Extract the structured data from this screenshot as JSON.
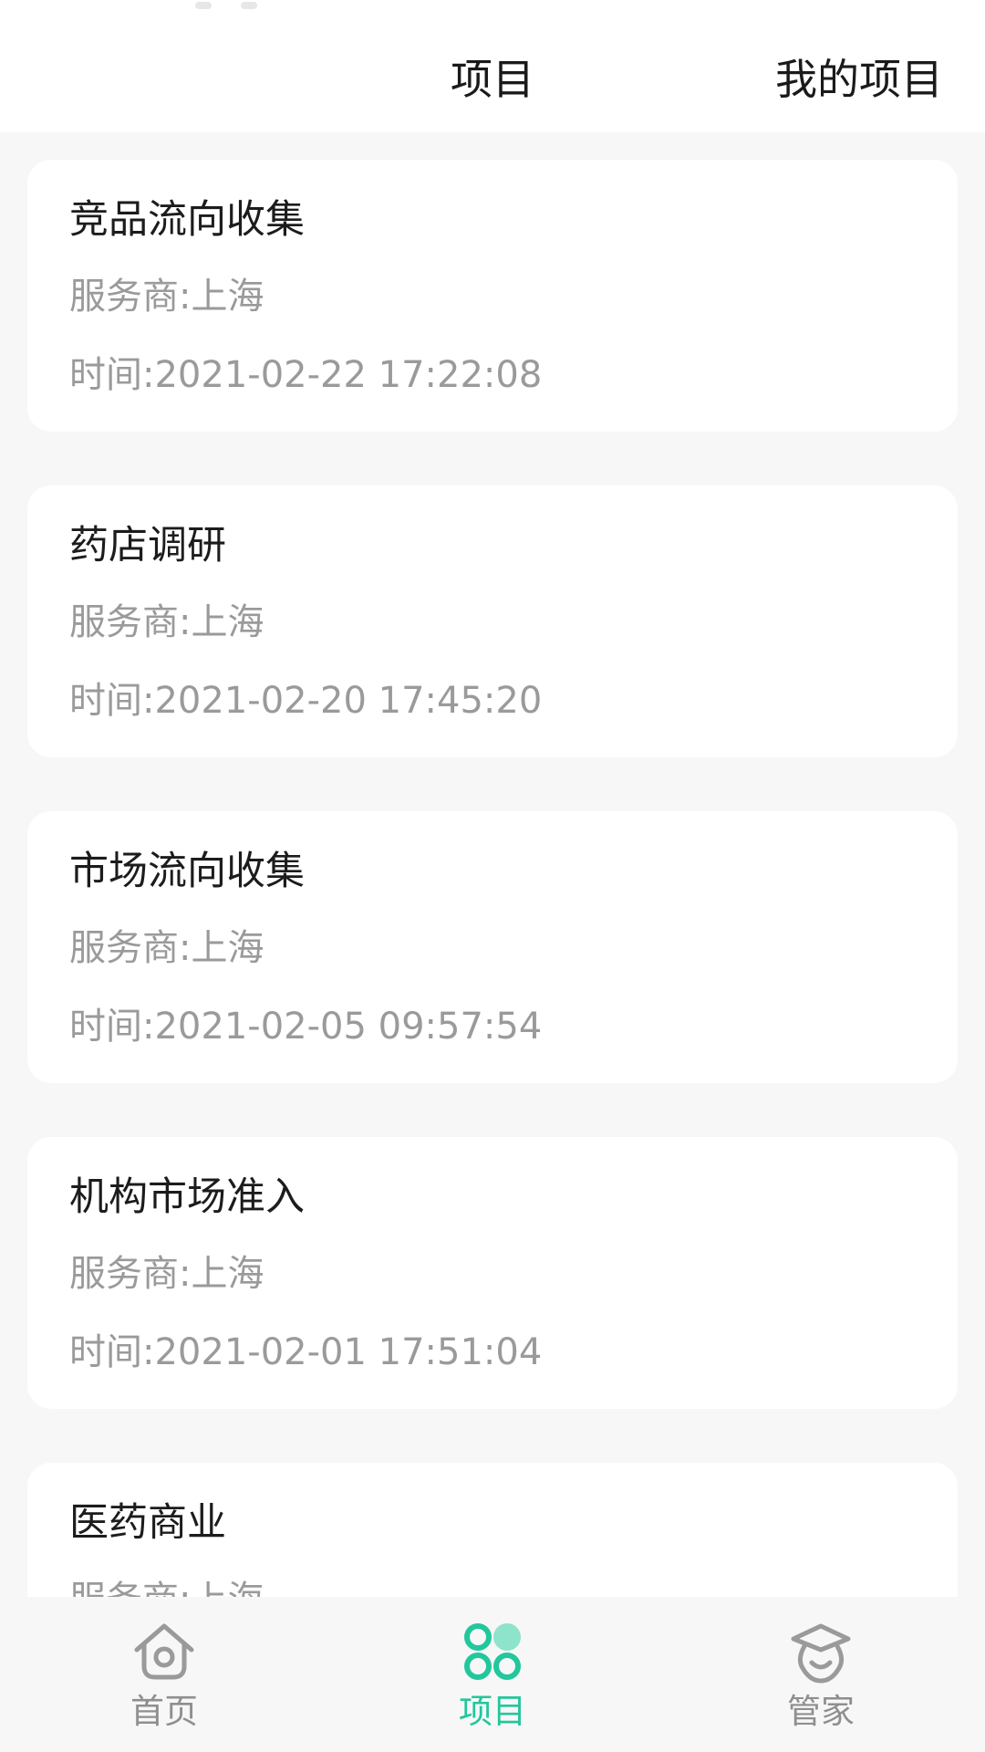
{
  "header": {
    "title": "项目",
    "action": "我的项目"
  },
  "items": [
    {
      "title": "竞品流向收集",
      "provider": "服务商:上海",
      "time": "时间:2021-02-22 17:22:08"
    },
    {
      "title": "药店调研",
      "provider": "服务商:上海",
      "time": "时间:2021-02-20 17:45:20"
    },
    {
      "title": "市场流向收集",
      "provider": "服务商:上海",
      "time": "时间:2021-02-05 09:57:54"
    },
    {
      "title": "机构市场准入",
      "provider": "服务商:上海",
      "time": "时间:2021-02-01 17:51:04"
    },
    {
      "title": "医药商业",
      "provider": "服务商:上海",
      "time": ""
    }
  ],
  "tabbar": {
    "tabs": [
      {
        "label": "首页",
        "icon": "home-icon"
      },
      {
        "label": "项目",
        "icon": "projects-icon"
      },
      {
        "label": "管家",
        "icon": "butler-icon"
      }
    ],
    "active_index": 1
  },
  "colors": {
    "accent": "#22c79c",
    "accent_light": "#8ee3cb",
    "inactive": "#8f8f8f",
    "background": "#f7f7f7",
    "card": "#ffffff",
    "title_text": "#1c1c1c",
    "secondary_text": "#9a9a9a"
  }
}
